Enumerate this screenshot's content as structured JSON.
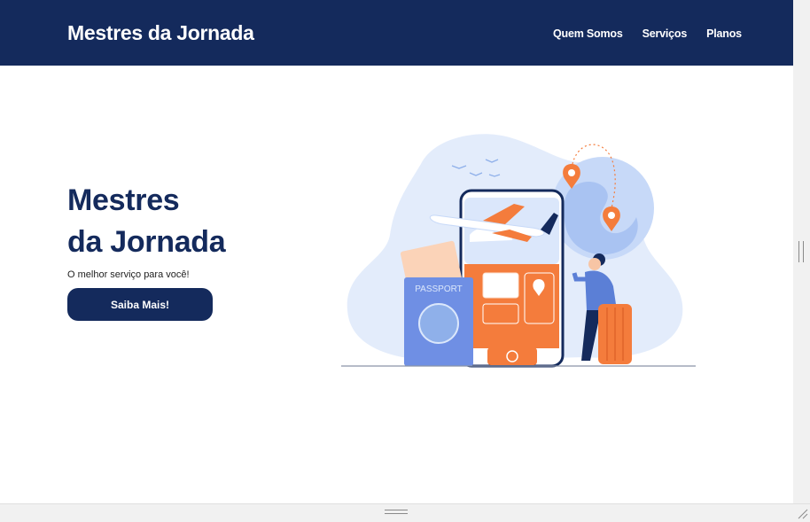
{
  "navbar": {
    "brand": "Mestres da Jornada",
    "links": [
      "Quem Somos",
      "Serviços",
      "Planos"
    ]
  },
  "hero": {
    "title_line1": "Mestres",
    "title_line2": "da Jornada",
    "subtitle": "O melhor serviço para você!",
    "cta_label": "Saiba Mais!"
  },
  "illustration": {
    "passport_label": "PASSPORT"
  },
  "colors": {
    "navy": "#142a5c",
    "orange": "#f47c3c",
    "light_blue": "#dbe7fb",
    "passport_blue": "#6f8fe4"
  }
}
